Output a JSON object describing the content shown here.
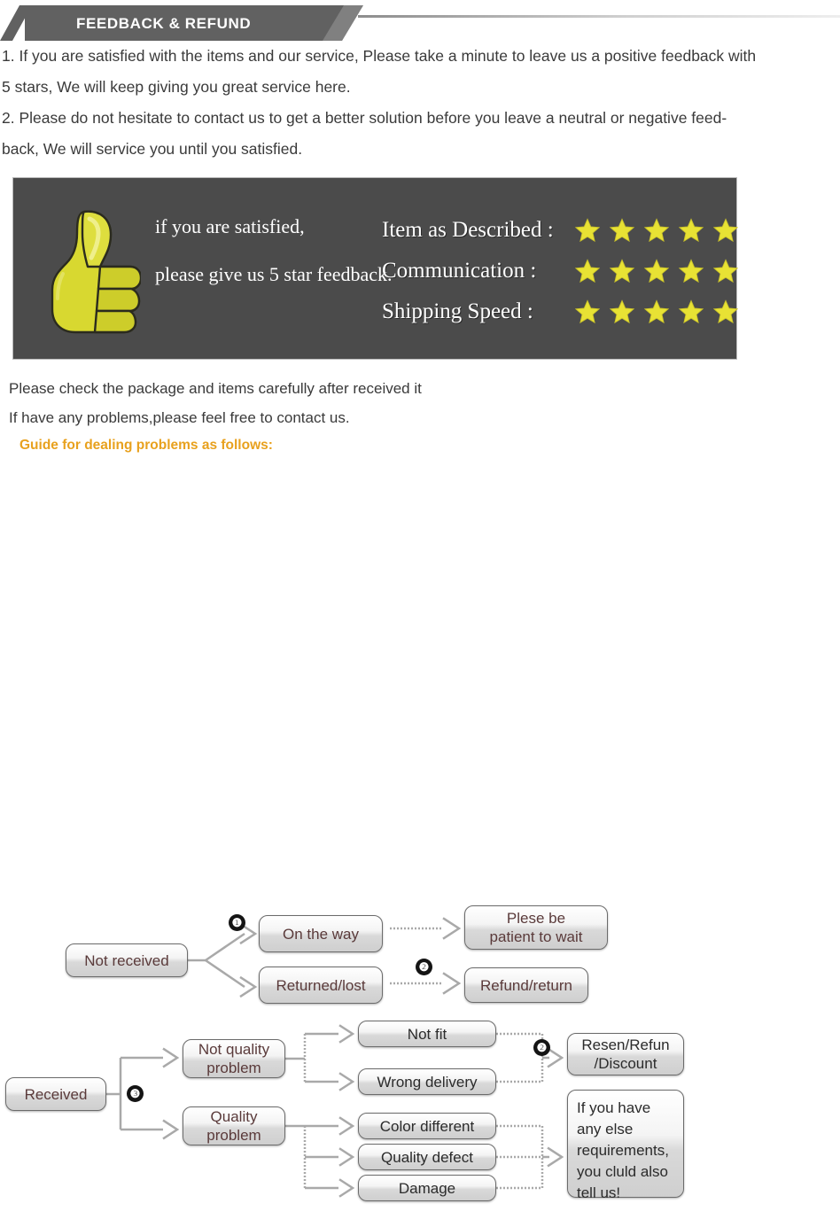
{
  "header": {
    "title": "FEEDBACK & REFUND"
  },
  "intro": {
    "paragraphs": [
      "1. If you are satisfied with the items and our service, Please take a minute to leave us a positive feedback with",
      "5 stars, We will keep giving you great service here.",
      "2. Please do not hesitate to contact us to get a better solution before you leave a neutral or negative feed-",
      "back, We will service you until you satisfied."
    ]
  },
  "feedback_banner": {
    "thumb_icon": "thumbs-up-icon",
    "line1": "if you are satisfied,",
    "line2": "please give us 5 star feedback.",
    "ratings": [
      {
        "label": "Item as Described :",
        "stars": 5
      },
      {
        "label": "Communication :",
        "stars": 5
      },
      {
        "label": "Shipping Speed :",
        "stars": 5
      }
    ],
    "colors": {
      "background": "#4b4b4b",
      "star": "#e8e234",
      "thumb": "#d4d42e",
      "text": "#ffffff"
    }
  },
  "notes": {
    "line1": "Please check the package and items carefully after received it",
    "line2": "If have any problems,please feel free to contact us.",
    "guide": "Guide for dealing problems as follows:",
    "guide_color": "#e8a11e"
  },
  "flow_not_received": {
    "root": "Not received",
    "badges": {
      "one": "❶",
      "two": "❷"
    },
    "branch_a": "On the way",
    "branch_b": "Returned/lost",
    "result_a": "Plese be\npatient to wait",
    "result_b": "Refund/return"
  },
  "flow_received": {
    "root": "Received",
    "badges": {
      "three": "❸",
      "two": "❷"
    },
    "branch_a": "Not quality\nproblem",
    "branch_b": "Quality\nproblem",
    "leaves_a": [
      "Not fit",
      "Wrong delivery"
    ],
    "leaves_b": [
      "Color different",
      "Quality defect",
      "Damage"
    ],
    "result_a": "Resen/Refun\n/Discount",
    "result_b": "If you have\nany else\nrequirements,\nyou cluld also\ntell us!"
  }
}
